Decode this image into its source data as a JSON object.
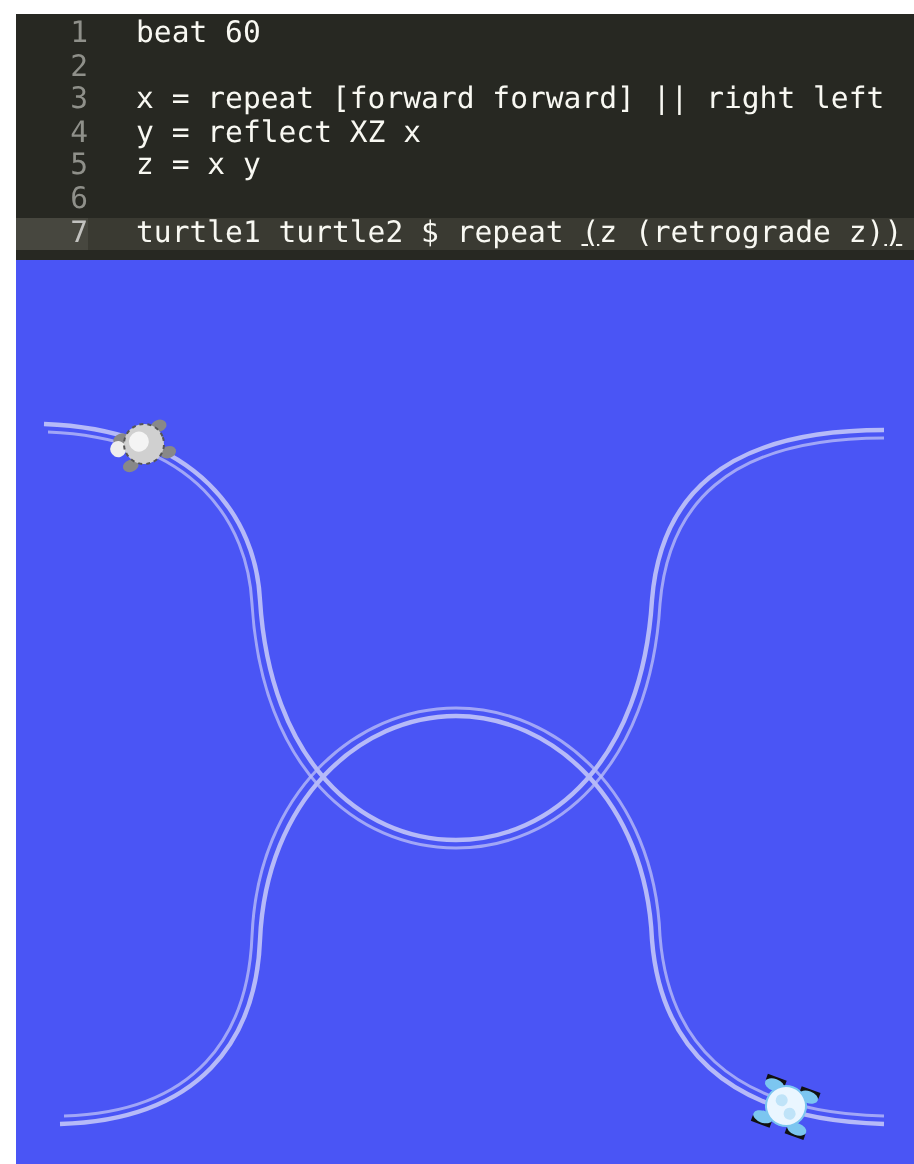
{
  "editor": {
    "lines": [
      {
        "number": "1",
        "segments": [
          {
            "text": "beat 60",
            "matched": false
          }
        ],
        "current": false
      },
      {
        "number": "2",
        "current": false
      },
      {
        "number": "3",
        "segments": [
          {
            "text": "x = repeat [forward forward] || right left",
            "matched": false
          }
        ],
        "current": false
      },
      {
        "number": "4",
        "segments": [
          {
            "text": "y = reflect XZ x",
            "matched": false
          }
        ],
        "current": false
      },
      {
        "number": "5",
        "segments": [
          {
            "text": "z = x y",
            "matched": false
          }
        ],
        "current": false
      },
      {
        "number": "6",
        "current": false
      },
      {
        "number": "7",
        "segments": [
          {
            "text": "turtle1 turtle2 $ repeat ",
            "matched": false
          },
          {
            "text": "(",
            "matched": true
          },
          {
            "text": "z (retrograde z)",
            "matched": false
          },
          {
            "text": ")",
            "matched": true
          }
        ],
        "current": true
      }
    ]
  }
}
